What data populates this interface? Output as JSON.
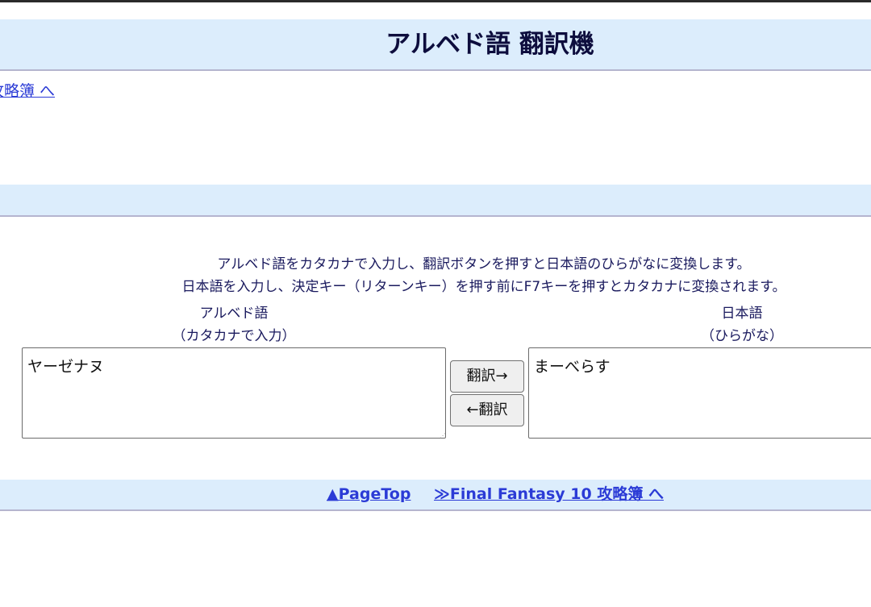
{
  "header": {
    "title": "アルベド語 翻訳機"
  },
  "nav": {
    "back_link": "攻略簿 へ"
  },
  "main": {
    "description_line1": "アルベド語をカタカナで入力し、翻訳ボタンを押すと日本語のひらがなに変換します。",
    "description_line2": "日本語を入力し、決定キー（リターンキー）を押す前にF7キーを押すとカタカナに変換されます。",
    "albhed": {
      "label": "アルベド語",
      "sublabel": "（カタカナで入力）",
      "value": "ヤーゼナヌ"
    },
    "japanese": {
      "label": "日本語",
      "sublabel": "（ひらがな）",
      "value": "まーべらす"
    },
    "buttons": {
      "translate_forward": "翻訳→",
      "translate_back": "←翻訳"
    }
  },
  "footer": {
    "pagetop_link": "▲PageTop",
    "ff10_link": "≫Final Fantasy 10 攻略簿 へ"
  },
  "colors": {
    "band_background": "#dcedfc",
    "link": "#2b3bd6",
    "text": "#1a1a5e"
  }
}
